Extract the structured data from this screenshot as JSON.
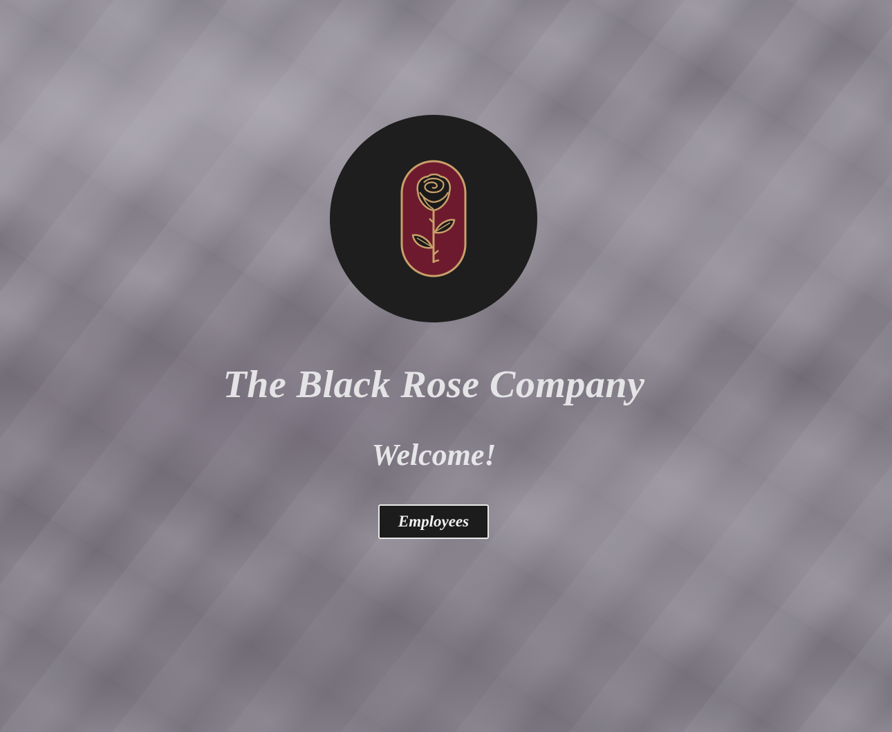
{
  "logo": {
    "icon": "rose-icon",
    "colors": {
      "circle": "#1e1e1e",
      "badge": "#6e1a2e",
      "outline": "#c9a06a",
      "bloom": "#1a1a1a"
    }
  },
  "title": "The Black Rose Company",
  "welcome": "Welcome!",
  "buttons": {
    "employees_label": "Employees"
  },
  "colors": {
    "text": "#e4e4e6",
    "button_bg": "#1c1c1c",
    "button_border": "#e8e8e8"
  }
}
